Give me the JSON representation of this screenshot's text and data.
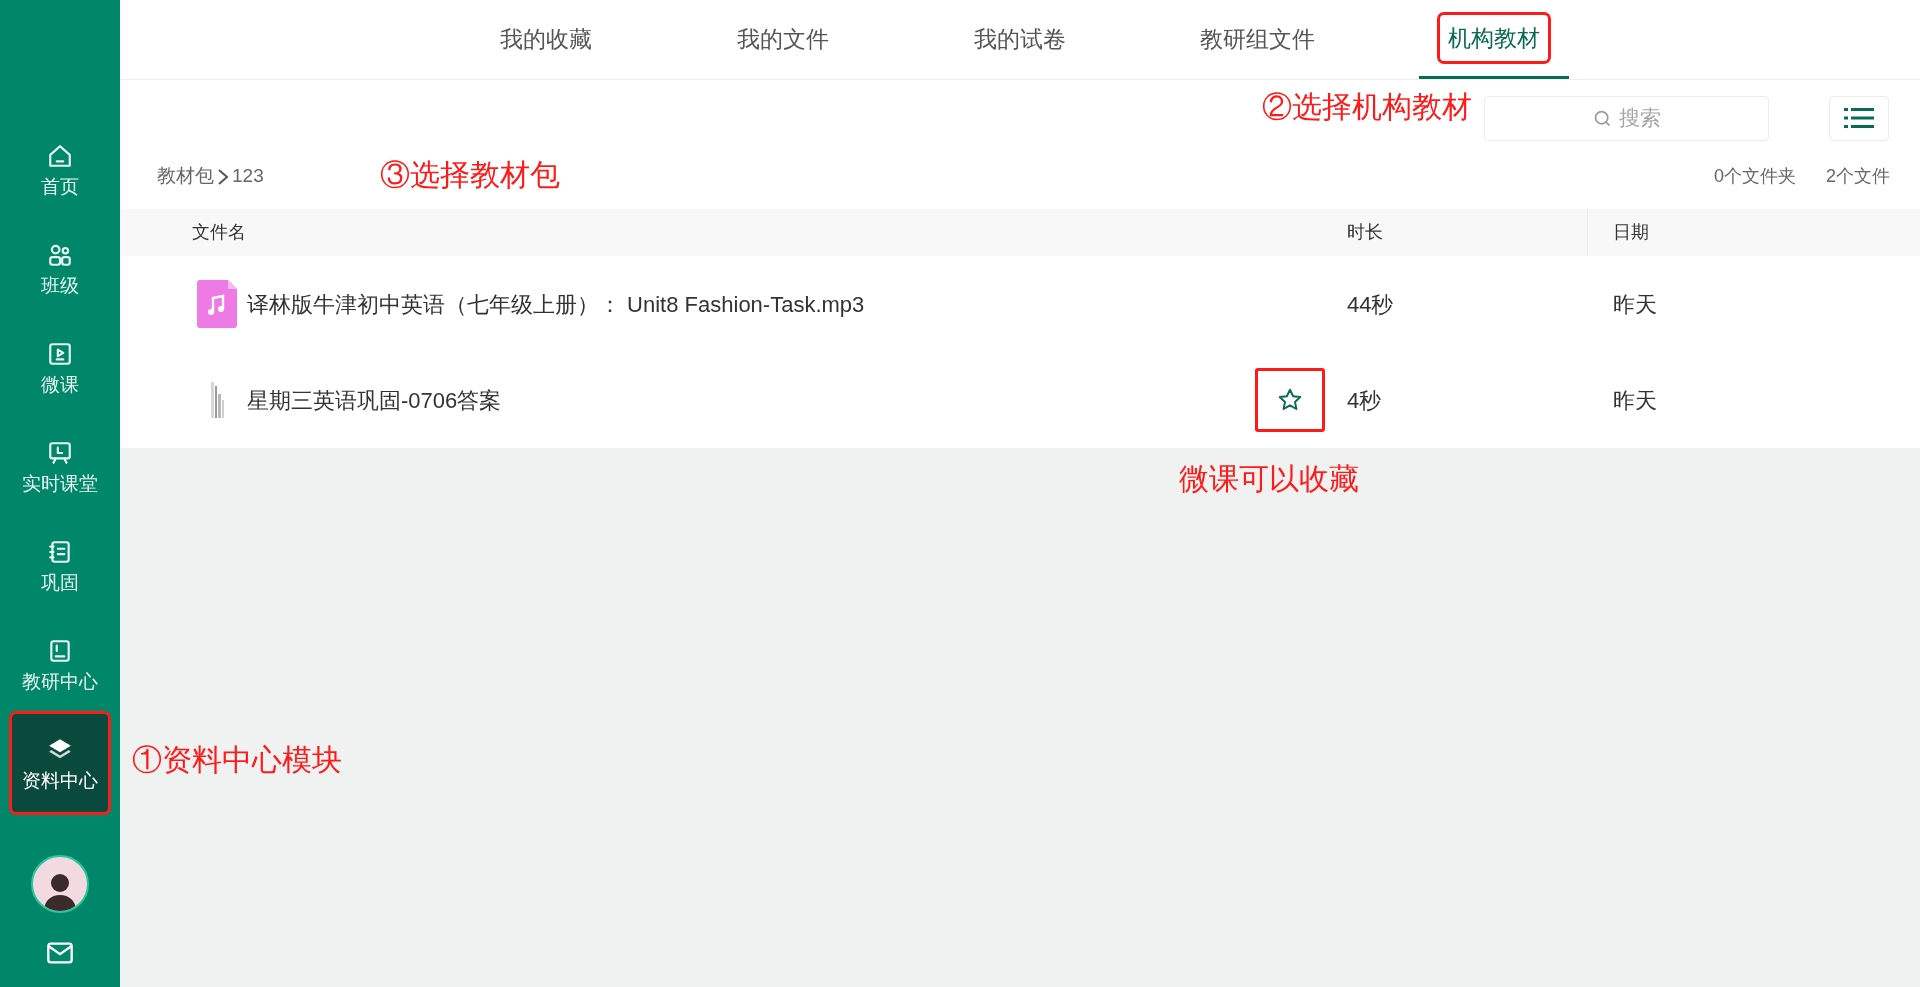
{
  "sidebar": {
    "items": [
      {
        "label": "首页",
        "selected": false,
        "highlighted": false
      },
      {
        "label": "班级",
        "selected": false,
        "highlighted": false
      },
      {
        "label": "微课",
        "selected": false,
        "highlighted": false
      },
      {
        "label": "实时课堂",
        "selected": false,
        "highlighted": false
      },
      {
        "label": "巩固",
        "selected": false,
        "highlighted": false
      },
      {
        "label": "教研中心",
        "selected": false,
        "highlighted": false
      },
      {
        "label": "资料中心",
        "selected": true,
        "highlighted": true
      }
    ]
  },
  "tabs": [
    {
      "label": "我的收藏",
      "selected": false,
      "highlighted": false
    },
    {
      "label": "我的文件",
      "selected": false,
      "highlighted": false
    },
    {
      "label": "我的试卷",
      "selected": false,
      "highlighted": false
    },
    {
      "label": "教研组文件",
      "selected": false,
      "highlighted": false
    },
    {
      "label": "机构教材",
      "selected": true,
      "highlighted": true
    }
  ],
  "search": {
    "placeholder": "搜索"
  },
  "breadcrumb": {
    "parent": "教材包",
    "current": "123"
  },
  "counts": {
    "folders": "0个文件夹",
    "files": "2个文件"
  },
  "table": {
    "columns": [
      "文件名",
      "时长",
      "日期"
    ],
    "rows": [
      {
        "kind": "audio",
        "name": "译林版牛津初中英语（七年级上册）： Unit8 Fashion-Task.mp3",
        "duration": "44秒",
        "date": "昨天",
        "star_shown": false
      },
      {
        "kind": "thumbnail",
        "name": "星期三英语巩固-0706答案",
        "duration": "4秒",
        "date": "昨天",
        "star_shown": true,
        "star_highlighted": true
      }
    ]
  },
  "annotations": [
    "①资料中心模块",
    "②选择机构教材",
    "③选择教材包",
    "微课可以收藏"
  ]
}
